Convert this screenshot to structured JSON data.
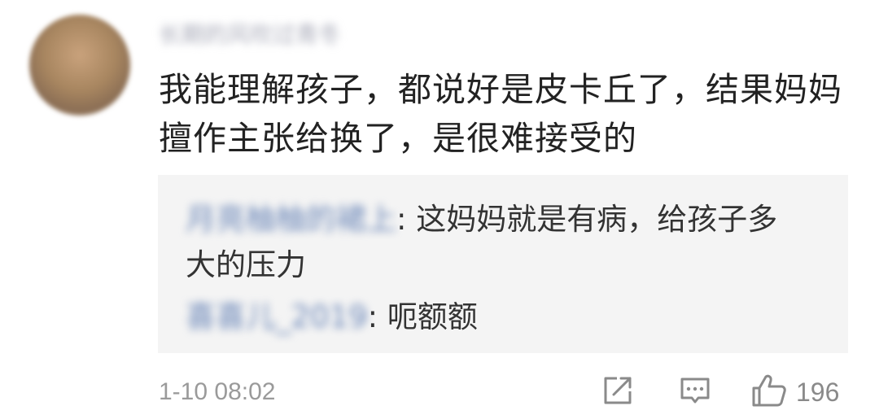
{
  "comment": {
    "username": "长期的风吹过青冬",
    "text_lines": [
      "我能理解孩子，都说好是皮卡丘了，结果妈妈",
      "擅作主张给换了，是很难接受的"
    ],
    "time": "1-10 08:02",
    "like_count": "196"
  },
  "replies": [
    {
      "user": "月亮柚柚的裙上",
      "separator": ":",
      "text_lines": [
        " 这妈妈就是有病，给孩子多",
        "大的压力"
      ]
    },
    {
      "user": "喜喜儿_2019",
      "separator": ":",
      "text_lines": [
        " 呃额额"
      ]
    }
  ],
  "icons": {
    "share": "share-icon",
    "reply": "comment-icon",
    "like": "thumbs-up-icon"
  },
  "colors": {
    "reply_background": "#f4f4f4",
    "username_blue": "#6a86b8",
    "meta_gray": "#9a9a9a"
  }
}
